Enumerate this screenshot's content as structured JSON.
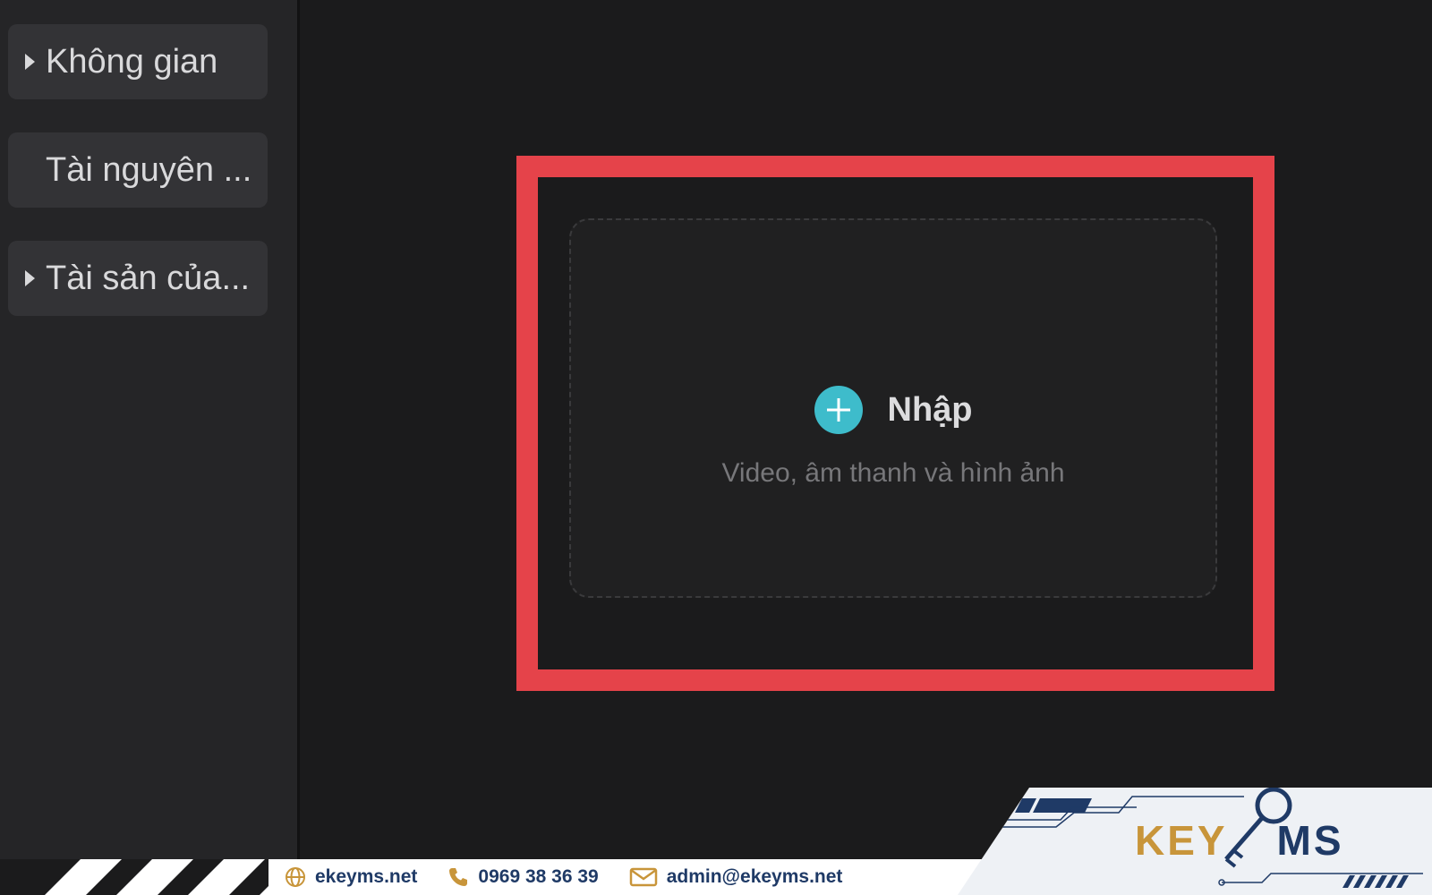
{
  "sidebar": {
    "items": [
      {
        "label": "Không gian",
        "expandable": true
      },
      {
        "label": "Tài nguyên ...",
        "expandable": false
      },
      {
        "label": "Tài sản của...",
        "expandable": true
      }
    ]
  },
  "importer": {
    "button_label": "Nhập",
    "subtitle": "Video, âm thanh và hình ảnh",
    "accent_color": "#3ebccb",
    "highlight_color": "#e5434a"
  },
  "footer": {
    "website": "ekeyms.net",
    "phone": "0969 38 36 39",
    "email": "admin@ekeyms.net",
    "logo_text_part1": "KEY",
    "logo_text_part2": "MS",
    "brand_blue": "#1f3a66",
    "brand_gold": "#c8953a"
  }
}
